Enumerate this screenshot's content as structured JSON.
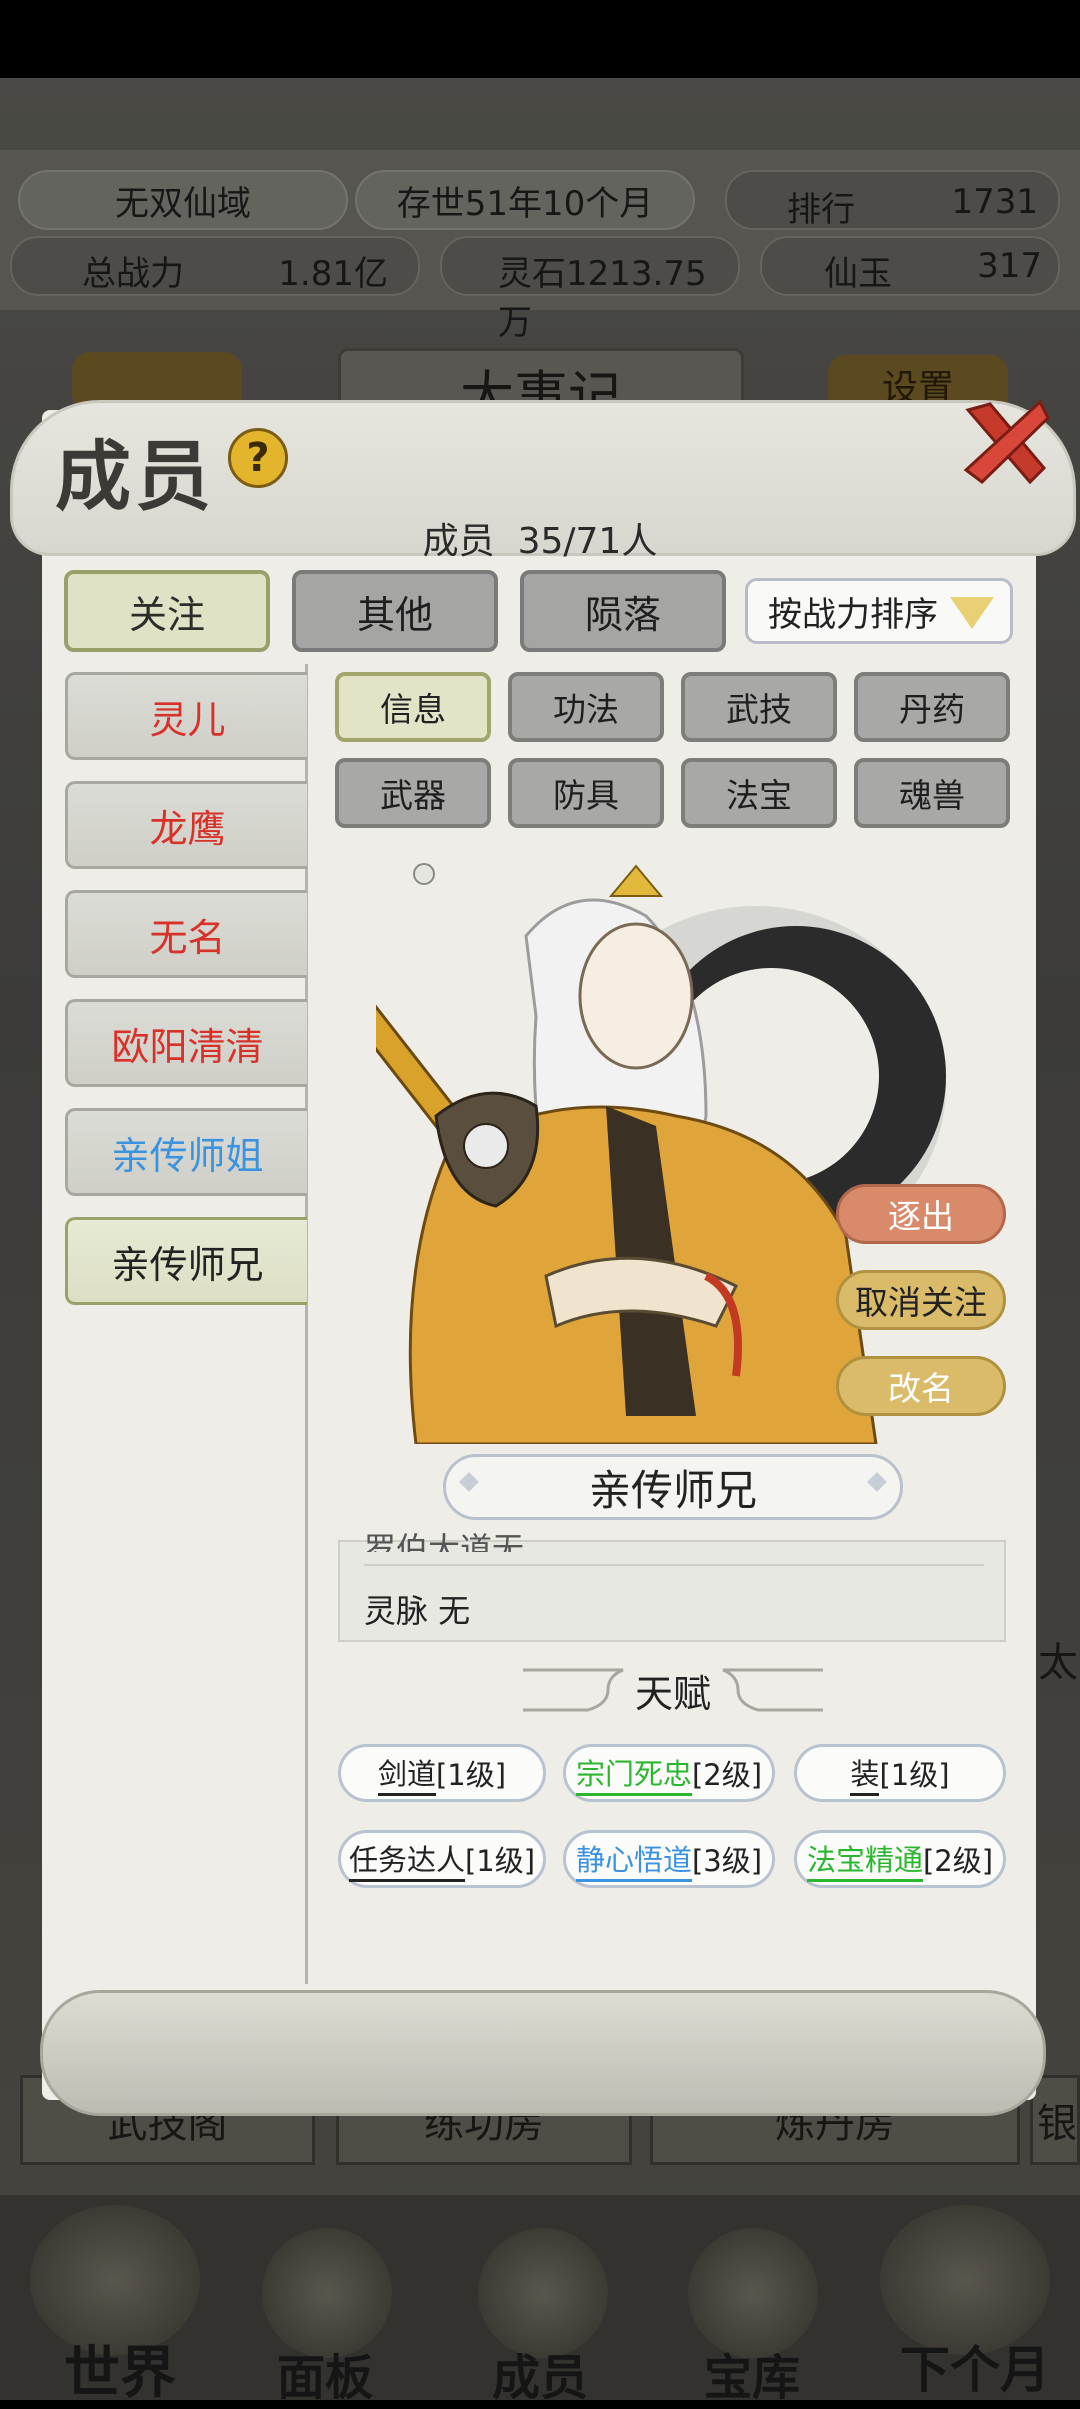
{
  "background": {
    "sect_name": "无双仙域",
    "age": "存世51年10个月",
    "rank_label": "排行",
    "rank_value": "1731",
    "power_label": "总战力",
    "power_value": "1.81亿",
    "spirit_stone": "灵石1213.75万",
    "jade_label": "仙玉",
    "jade_value": "317",
    "events_title": "大事记",
    "settings_label": "设置",
    "rooms": [
      "武技阁",
      "练功房",
      "炼丹房",
      "银"
    ],
    "right_edge_text": "太",
    "nav": [
      "世界",
      "面板",
      "成员",
      "宝库",
      "下个月"
    ]
  },
  "dialog": {
    "title": "成员",
    "member_count_label": "成员",
    "member_count": "35/71人",
    "tabs": [
      "关注",
      "其他",
      "陨落"
    ],
    "sort_label": "按战力排序",
    "members": [
      {
        "name": "灵儿",
        "color": "#d8312a"
      },
      {
        "name": "龙鹰",
        "color": "#d8312a"
      },
      {
        "name": "无名",
        "color": "#d8312a"
      },
      {
        "name": "欧阳清清",
        "color": "#d8312a"
      },
      {
        "name": "亲传师姐",
        "color": "#3b93e0"
      },
      {
        "name": "亲传师兄",
        "color": "#222222"
      }
    ],
    "sub_tabs": [
      "信息",
      "功法",
      "武技",
      "丹药",
      "武器",
      "防具",
      "法宝",
      "魂兽"
    ],
    "actions": {
      "expel": "逐出",
      "unfollow": "取消关注",
      "rename": "改名"
    },
    "selected_name": "亲传师兄",
    "info_partial": "罗伯大道无",
    "info_line": "灵脉 无",
    "talent_title": "天赋",
    "talents": [
      {
        "name": "剑道",
        "level": "[1级]",
        "color": "#222222"
      },
      {
        "name": "宗门死忠",
        "level": "[2级]",
        "color": "#2bb62f"
      },
      {
        "name": "装",
        "level": "[1级]",
        "color": "#222222"
      },
      {
        "name": "任务达人",
        "level": "[1级]",
        "color": "#222222"
      },
      {
        "name": "静心悟道",
        "level": "[3级]",
        "color": "#3b93e0"
      },
      {
        "name": "法宝精通",
        "level": "[2级]",
        "color": "#2bb62f"
      }
    ]
  }
}
